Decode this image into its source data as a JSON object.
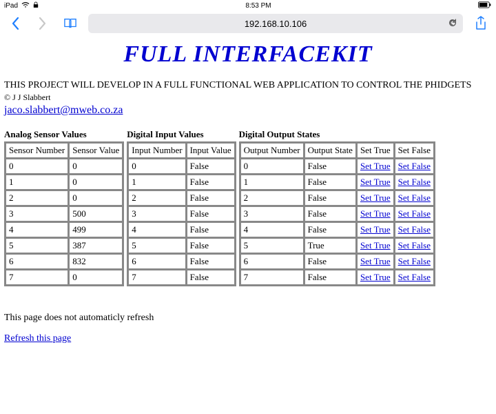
{
  "status": {
    "device": "iPad",
    "time": "8:53 PM"
  },
  "nav": {
    "address": "192.168.10.106"
  },
  "page": {
    "title": "FULL INTERFACEKIT",
    "intro": "THIS PROJECT WILL DEVELOP IN A FULL FUNCTIONAL WEB APPLICATION TO CONTROL THE PHIDGETS",
    "copyright": "© J J Slabbert",
    "email": "jaco.slabbert@mweb.co.za",
    "note": "This page does not automaticly refresh",
    "refresh": "Refresh this page"
  },
  "analog": {
    "title": "Analog Sensor Values",
    "headers": [
      "Sensor Number",
      "Sensor Value"
    ],
    "rows": [
      {
        "n": "0",
        "v": "0"
      },
      {
        "n": "1",
        "v": "0"
      },
      {
        "n": "2",
        "v": "0"
      },
      {
        "n": "3",
        "v": "500"
      },
      {
        "n": "4",
        "v": "499"
      },
      {
        "n": "5",
        "v": "387"
      },
      {
        "n": "6",
        "v": "832"
      },
      {
        "n": "7",
        "v": "0"
      }
    ]
  },
  "digitalIn": {
    "title": "Digital Input Values",
    "headers": [
      "Input Number",
      "Input Value"
    ],
    "rows": [
      {
        "n": "0",
        "v": "False"
      },
      {
        "n": "1",
        "v": "False"
      },
      {
        "n": "2",
        "v": "False"
      },
      {
        "n": "3",
        "v": "False"
      },
      {
        "n": "4",
        "v": "False"
      },
      {
        "n": "5",
        "v": "False"
      },
      {
        "n": "6",
        "v": "False"
      },
      {
        "n": "7",
        "v": "False"
      }
    ]
  },
  "digitalOut": {
    "title": "Digital Output States",
    "headers": [
      "Output Number",
      "Output State",
      "Set True",
      "Set False"
    ],
    "setTrue": "Set True",
    "setFalse": "Set False",
    "rows": [
      {
        "n": "0",
        "v": "False"
      },
      {
        "n": "1",
        "v": "False"
      },
      {
        "n": "2",
        "v": "False"
      },
      {
        "n": "3",
        "v": "False"
      },
      {
        "n": "4",
        "v": "False"
      },
      {
        "n": "5",
        "v": "True"
      },
      {
        "n": "6",
        "v": "False"
      },
      {
        "n": "7",
        "v": "False"
      }
    ]
  }
}
